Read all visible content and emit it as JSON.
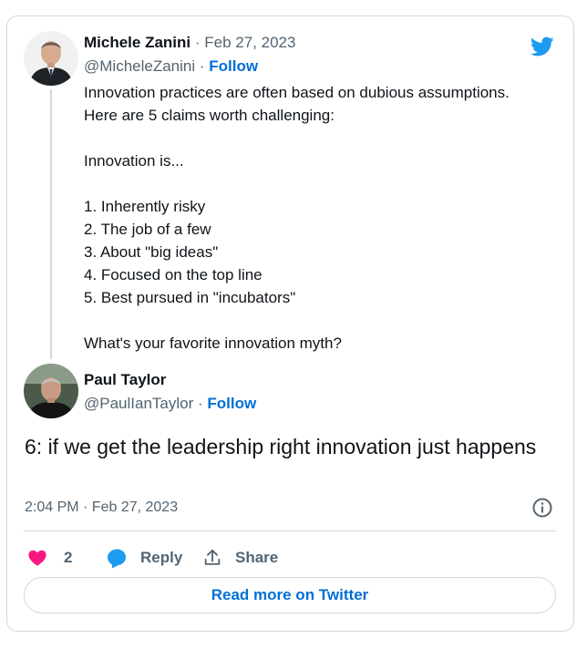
{
  "quoted_tweet": {
    "author_name": "Michele Zanini",
    "date": "Feb 27, 2023",
    "handle": "@MicheleZanini",
    "follow_label": "Follow",
    "text_lines": [
      "Innovation practices are often based on dubious assumptions.",
      "Here are 5 claims worth challenging:",
      "",
      "Innovation is...",
      "",
      "1. Inherently risky",
      "2. The job of a few",
      "3. About \"big ideas\"",
      "4. Focused on the top line",
      "5. Best pursued in \"incubators\"",
      "",
      "What's your favorite innovation myth?"
    ]
  },
  "reply_tweet": {
    "author_name": "Paul Taylor",
    "handle": "@PaulIanTaylor",
    "follow_label": "Follow",
    "text": "6: if we get the leadership right innovation just happens",
    "timestamp": "2:04 PM · Feb 27, 2023"
  },
  "actions": {
    "like_count": "2",
    "reply_label": "Reply",
    "share_label": "Share"
  },
  "read_more_label": "Read more on Twitter",
  "colors": {
    "twitter_blue": "#1d9bf0",
    "link_blue": "#006fd6",
    "heart_pink": "#f91880",
    "muted": "#536471",
    "border": "#cfd9de"
  }
}
